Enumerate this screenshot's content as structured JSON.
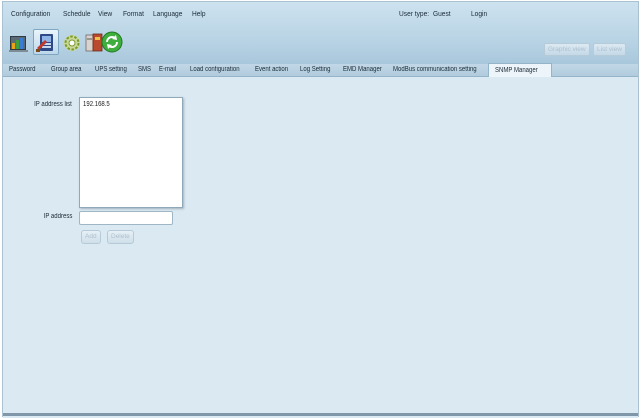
{
  "menu": {
    "items": [
      {
        "label": "Configuration"
      },
      {
        "label": "Schedule"
      },
      {
        "label": "View"
      },
      {
        "label": "Format"
      },
      {
        "label": "Language"
      },
      {
        "label": "Help"
      }
    ]
  },
  "user": {
    "type_label": "User type:",
    "type_value": "Guest",
    "login_label": "Login"
  },
  "toolbar": {
    "icons": [
      "monitor-chart-icon",
      "configuration-icon",
      "schedule-gear-icon",
      "ups-battery-icon",
      "refresh-icon"
    ],
    "graphic_view_label": "Graphic view",
    "list_view_label": "List view"
  },
  "tabs": [
    {
      "label": "Password"
    },
    {
      "label": "Group area"
    },
    {
      "label": "UPS setting"
    },
    {
      "label": "SMS"
    },
    {
      "label": "E-mail"
    },
    {
      "label": "Load configuration"
    },
    {
      "label": "Event action"
    },
    {
      "label": "Log Setting"
    },
    {
      "label": "EMD Manager"
    },
    {
      "label": "ModBus communication setting"
    },
    {
      "label": "SNMP Manager"
    }
  ],
  "selected_tab": "SNMP Manager",
  "snmp": {
    "ip_list_label": "IP address list",
    "ip_list_items": [
      "192.168.5"
    ],
    "ip_address_label": "IP address",
    "ip_address_value": "",
    "add_label": "Add",
    "delete_label": "Delete"
  },
  "colors": {
    "background": "#dbe9f2",
    "header": "#b9d4e5",
    "disabled_text": "#aebfcc"
  }
}
